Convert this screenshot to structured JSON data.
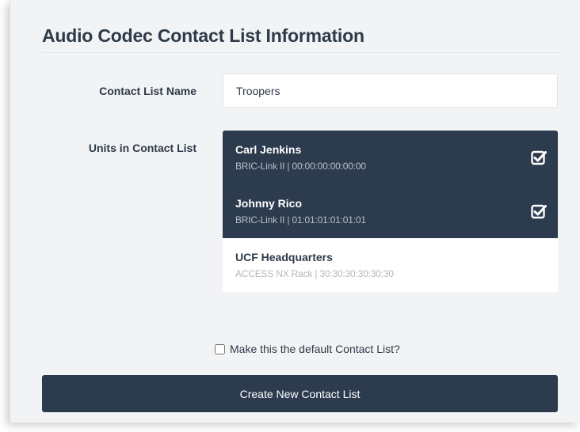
{
  "form": {
    "title": "Audio Codec Contact List Information",
    "contact_list_name_label": "Contact List Name",
    "contact_list_name_value": "Troopers",
    "units_label": "Units in Contact List",
    "units": [
      {
        "name": "Carl Jenkins",
        "detail": "BRIC-Link II | 00:00:00:00:00:00",
        "selected": true
      },
      {
        "name": "Johnny Rico",
        "detail": "BRIC-Link II | 01:01:01:01:01:01",
        "selected": true
      },
      {
        "name": "UCF Headquarters",
        "detail": "ACCESS NX Rack | 30:30:30:30:30:30",
        "selected": false
      }
    ],
    "default_checkbox_label": "Make this the default Contact List?",
    "default_checked": false,
    "submit_label": "Create New Contact List"
  },
  "colors": {
    "panel_bg": "#f2f3f5",
    "selected_bg": "#2c3b4d",
    "button_bg": "#2c3b4d",
    "text": "#2e3a48"
  }
}
